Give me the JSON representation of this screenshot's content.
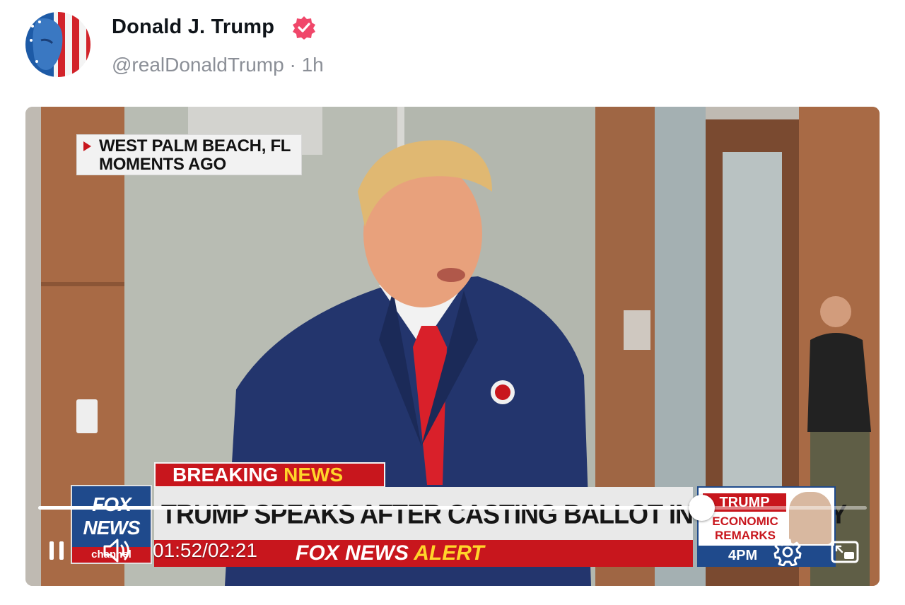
{
  "post": {
    "display_name": "Donald J. Trump",
    "verified_icon": "verified-badge-icon",
    "handle": "@realDonaldTrump",
    "separator": "·",
    "time_ago": "1h"
  },
  "video": {
    "location_overlay": {
      "line1": "WEST PALM BEACH, FL",
      "line2": "MOMENTS AGO"
    },
    "chyron": {
      "breaking_word1": "BREAKING",
      "breaking_word2": "NEWS",
      "headline": "TRUMP SPEAKS AFTER CASTING BALLOT IN FL PRIMARY",
      "alert_word1": "FOX NEWS",
      "alert_word2": "ALERT",
      "network_logo_line1": "FOX",
      "network_logo_line2": "NEWS",
      "network_logo_line3": "channel"
    },
    "side_promo": {
      "title": "TRUMP",
      "line1": "ECONOMIC",
      "line2": "REMARKS",
      "time": "4PM"
    },
    "player": {
      "current_time": "01:52",
      "divider": "/",
      "duration": "02:21",
      "progress_fraction": 0.8,
      "pause_icon": "pause-icon",
      "volume_icon": "volume-icon",
      "settings_icon": "gear-icon",
      "pip_icon": "picture-in-picture-icon"
    }
  },
  "colors": {
    "verified": "#f0476a",
    "fox_red": "#c8161d",
    "fox_blue": "#1f4a8c",
    "alert_yellow": "#ffd52a",
    "handle_gray": "#8b8f97"
  }
}
